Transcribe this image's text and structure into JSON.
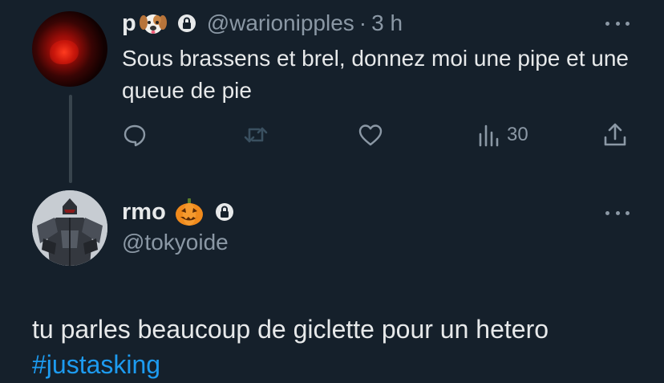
{
  "tweet1": {
    "display_name": "p",
    "name_emoji": "dog-face-emoji",
    "protected": true,
    "handle": "@warionipples",
    "separator": "·",
    "time": "3 h",
    "text": "Sous brassens et brel, donnez moi une pipe et une queue de pie",
    "actions": {
      "reply_icon": "reply-icon",
      "retweet_icon": "retweet-icon",
      "like_icon": "like-icon",
      "views_icon": "views-icon",
      "views_count": "30",
      "share_icon": "share-icon"
    }
  },
  "tweet2": {
    "display_name": "rmo",
    "name_emoji": "jack-o-lantern-emoji",
    "protected": true,
    "handle": "@tokyoide",
    "text": "tu parles beaucoup de giclette pour un hetero",
    "hashtag": "#justasking"
  },
  "colors": {
    "background": "#15202b",
    "text_primary": "#e7e9ea",
    "text_secondary": "#8b98a5",
    "link": "#1d9bf0",
    "thread_line": "#38444d"
  }
}
